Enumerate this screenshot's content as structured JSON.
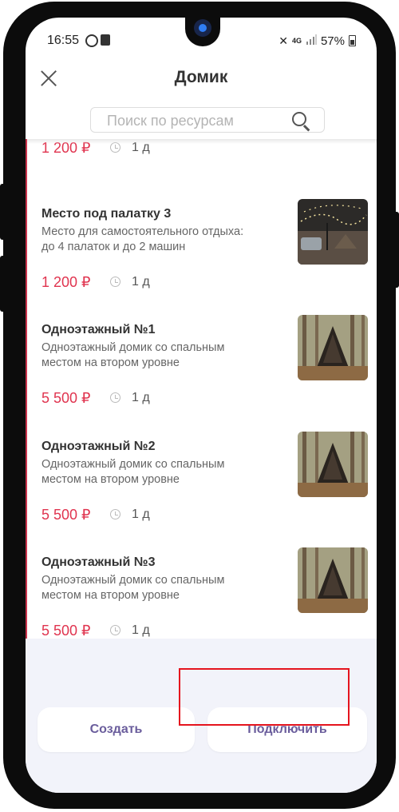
{
  "status_bar": {
    "time": "16:55",
    "battery": "57%",
    "network": "4G"
  },
  "header": {
    "title": "Домик"
  },
  "search": {
    "placeholder": "Поиск по ресурсам"
  },
  "partial_item": {
    "price": "1 200 ₽",
    "duration": "1 д"
  },
  "items": [
    {
      "name": "Место под палатку 3",
      "desc_line1": "Место для самостоятельного отдыха:",
      "desc_line2": "до 4 палаток и до 2 машин",
      "price": "1 200 ₽",
      "duration": "1 д",
      "thumb": "camp-lights"
    },
    {
      "name": "Одноэтажный №1",
      "desc_line1": "Одноэтажный домик со спальным",
      "desc_line2": "местом на втором уровне",
      "price": "5 500 ₽",
      "duration": "1 д",
      "thumb": "a-frame-cabin"
    },
    {
      "name": "Одноэтажный №2",
      "desc_line1": "Одноэтажный домик со спальным",
      "desc_line2": "местом на втором уровне",
      "price": "5 500 ₽",
      "duration": "1 д",
      "thumb": "a-frame-cabin"
    },
    {
      "name": "Одноэтажный №3",
      "desc_line1": "Одноэтажный домик со спальным",
      "desc_line2": "местом на втором уровне",
      "price": "5 500 ₽",
      "duration": "1 д",
      "thumb": "a-frame-cabin"
    }
  ],
  "footer": {
    "create_label": "Создать",
    "connect_label": "Подключить"
  },
  "colors": {
    "price": "#e0344f",
    "button_text": "#6a5d9c",
    "highlight": "#e5141e"
  }
}
